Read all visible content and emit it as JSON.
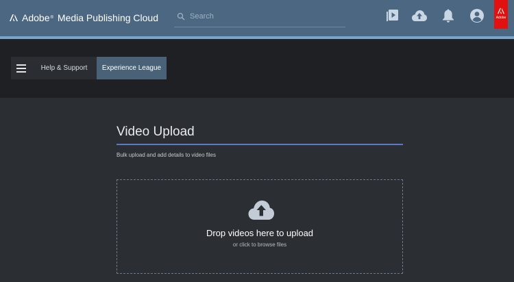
{
  "header": {
    "brand": "Adobe",
    "product": "Media Publishing Cloud",
    "search_placeholder": "Search",
    "icons": [
      "video-library-icon",
      "upload-cloud-icon",
      "bell-icon",
      "user-icon"
    ],
    "adobe_badge": "Adobe",
    "upload_progress": 1.0
  },
  "subnav": {
    "menu_icon": "hamburger-icon",
    "items": [
      {
        "label": "Help & Support",
        "active": false
      },
      {
        "label": "Experience League",
        "active": true
      }
    ]
  },
  "main": {
    "title": "Video Upload",
    "subtitle": "Bulk upload and add details to video files",
    "dropzone": {
      "icon": "upload-cloud-icon",
      "primary": "Drop videos here to upload",
      "secondary": "or click to browse files"
    }
  },
  "colors": {
    "header_bg": "#4b6781",
    "accent": "#5a79c8",
    "adobe_red": "#e0110e",
    "active_tab": "#4a6277"
  }
}
